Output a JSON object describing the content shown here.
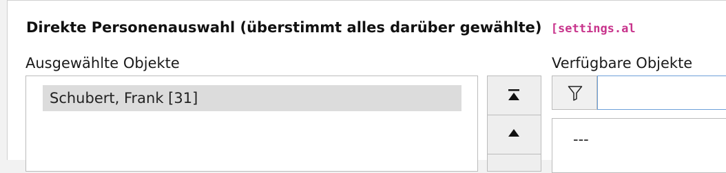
{
  "field": {
    "title": "Direkte Personenauswahl (überstimmt alles darüber gewählte)",
    "settings_key": "[settings.al"
  },
  "selected": {
    "label": "Ausgewählte Objekte",
    "items": [
      "Schubert, Frank [31]"
    ]
  },
  "controls": {
    "move_top_icon": "move-to-top-icon",
    "move_up_icon": "move-up-icon"
  },
  "available": {
    "label": "Verfügbare Objekte",
    "filter_icon": "filter-icon",
    "filter_value": "",
    "items": [
      "---"
    ]
  },
  "colors": {
    "settings_key": "#c8348c",
    "filter_focus_border": "#6c9fd9",
    "selected_item_bg": "#dcdcdc"
  }
}
